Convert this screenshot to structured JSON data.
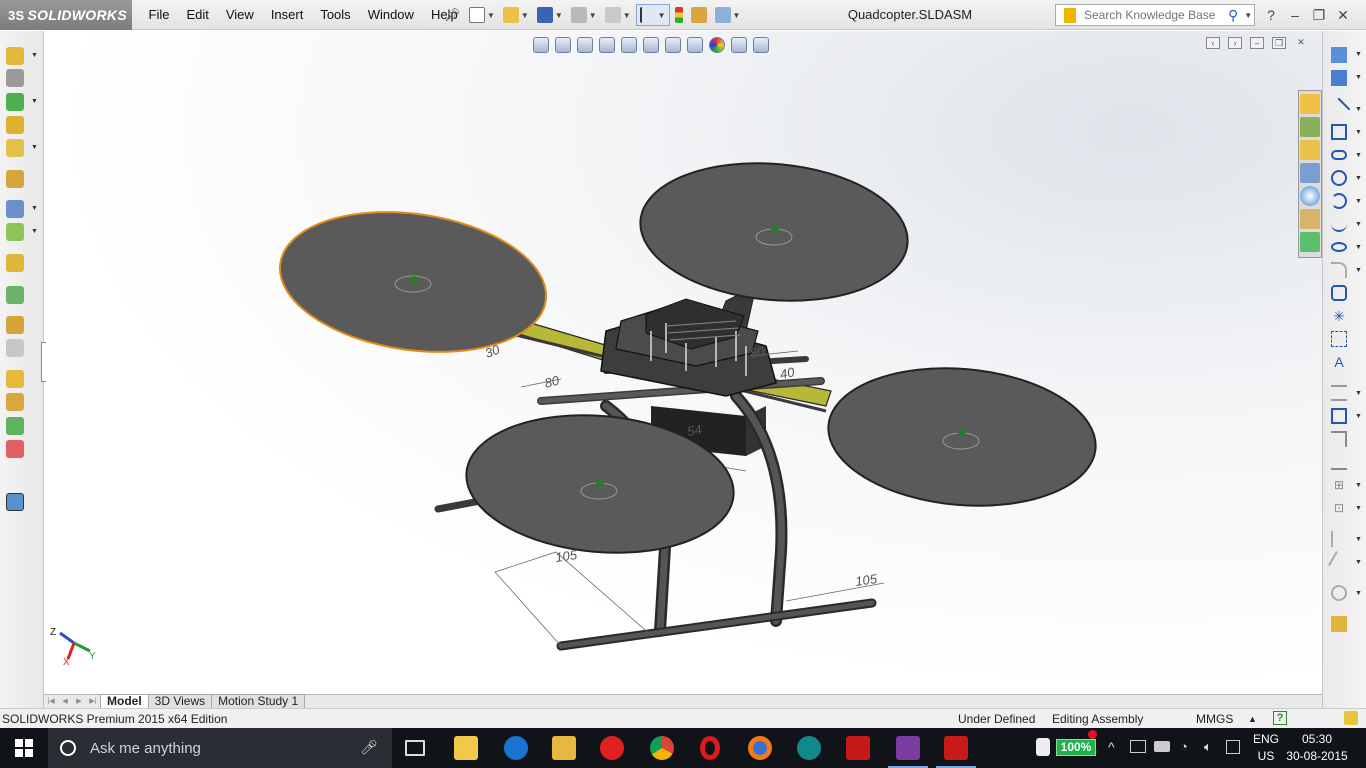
{
  "app": {
    "logo_text": "SOLIDWORKS",
    "logo_prefix": "3S",
    "document_title": "Quadcopter.SLDASM"
  },
  "menu": [
    "File",
    "Edit",
    "View",
    "Insert",
    "Tools",
    "Window",
    "Help"
  ],
  "search": {
    "placeholder": "Search Knowledge Base"
  },
  "window_controls": {
    "help": "?",
    "minimize": "–",
    "restore": "❐",
    "close": "✕"
  },
  "viewport": {
    "dimension_labels": [
      "30",
      "80",
      "80",
      "54",
      "105",
      "105",
      "40"
    ],
    "triad": {
      "z": "Z",
      "x": "X",
      "y": "Y"
    }
  },
  "tabs": [
    {
      "label": "Model",
      "active": true
    },
    {
      "label": "3D Views",
      "active": false
    },
    {
      "label": "Motion Study 1",
      "active": false
    }
  ],
  "status": {
    "edition": "SOLIDWORKS Premium 2015 x64 Edition",
    "definition": "Under Defined",
    "mode": "Editing Assembly",
    "units": "MMGS",
    "units_caret": "▲",
    "help": "?"
  },
  "taskbar": {
    "search_placeholder": "Ask me anything",
    "battery": "100%",
    "language_line1": "ENG",
    "language_line2": "US",
    "time": "05:30",
    "date": "30-08-2015",
    "apps": [
      "task-view",
      "file-explorer",
      "edge",
      "folder",
      "power",
      "chrome",
      "opera",
      "firefox",
      "arduino",
      "acrobat",
      "onenote",
      "solidworks"
    ]
  },
  "colors": {
    "accent": "#2b5fb4",
    "plate": "#595959",
    "plate_selected_edge": "#e08a1a",
    "arm": "#c8c828",
    "taskbar": "#101418"
  }
}
